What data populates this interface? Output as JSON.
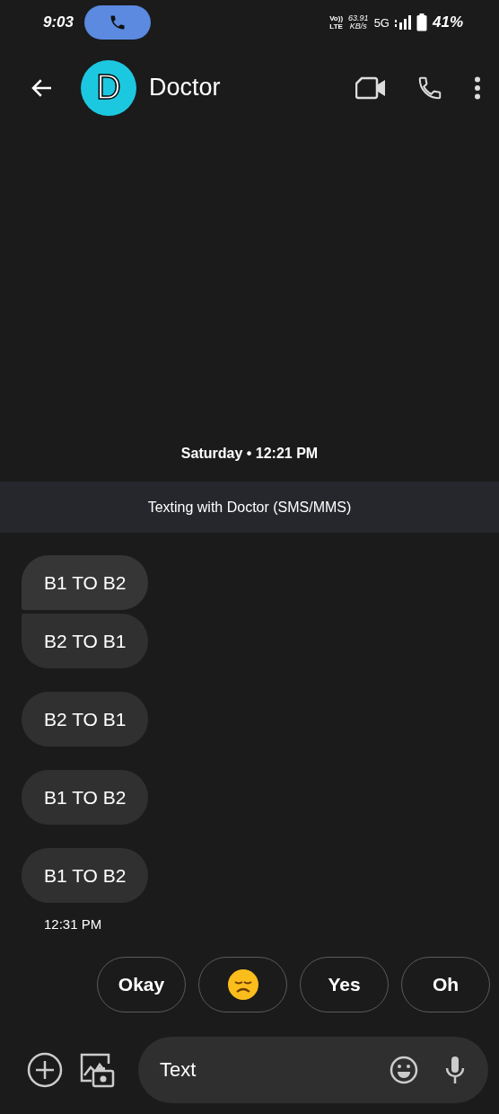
{
  "status_bar": {
    "time": "9:03",
    "call_active": true,
    "volte": "Vo))",
    "lte": "LTE",
    "speed_value": "63.91",
    "speed_unit": "KB/s",
    "network": "5G",
    "battery": "41%"
  },
  "header": {
    "avatar_letter": "D",
    "title": "Doctor"
  },
  "date_separator": "Saturday • 12:21 PM",
  "banner": "Texting with Doctor  (SMS/MMS)",
  "messages": [
    {
      "text": "B1 TO B2",
      "grouped_with_next": true
    },
    {
      "text": "B2 TO B1",
      "grouped_with_next": false
    },
    {
      "text": "B2 TO B1",
      "grouped_with_next": false
    },
    {
      "text": "B1 TO B2",
      "grouped_with_next": false
    },
    {
      "text": "B1 TO B2",
      "grouped_with_next": false
    }
  ],
  "last_message_time": "12:31 PM",
  "suggestions": [
    {
      "kind": "text",
      "label": "Okay"
    },
    {
      "kind": "emoji"
    },
    {
      "kind": "text",
      "label": "Yes"
    },
    {
      "kind": "text",
      "label": "Oh"
    }
  ],
  "compose": {
    "placeholder": "Text"
  }
}
